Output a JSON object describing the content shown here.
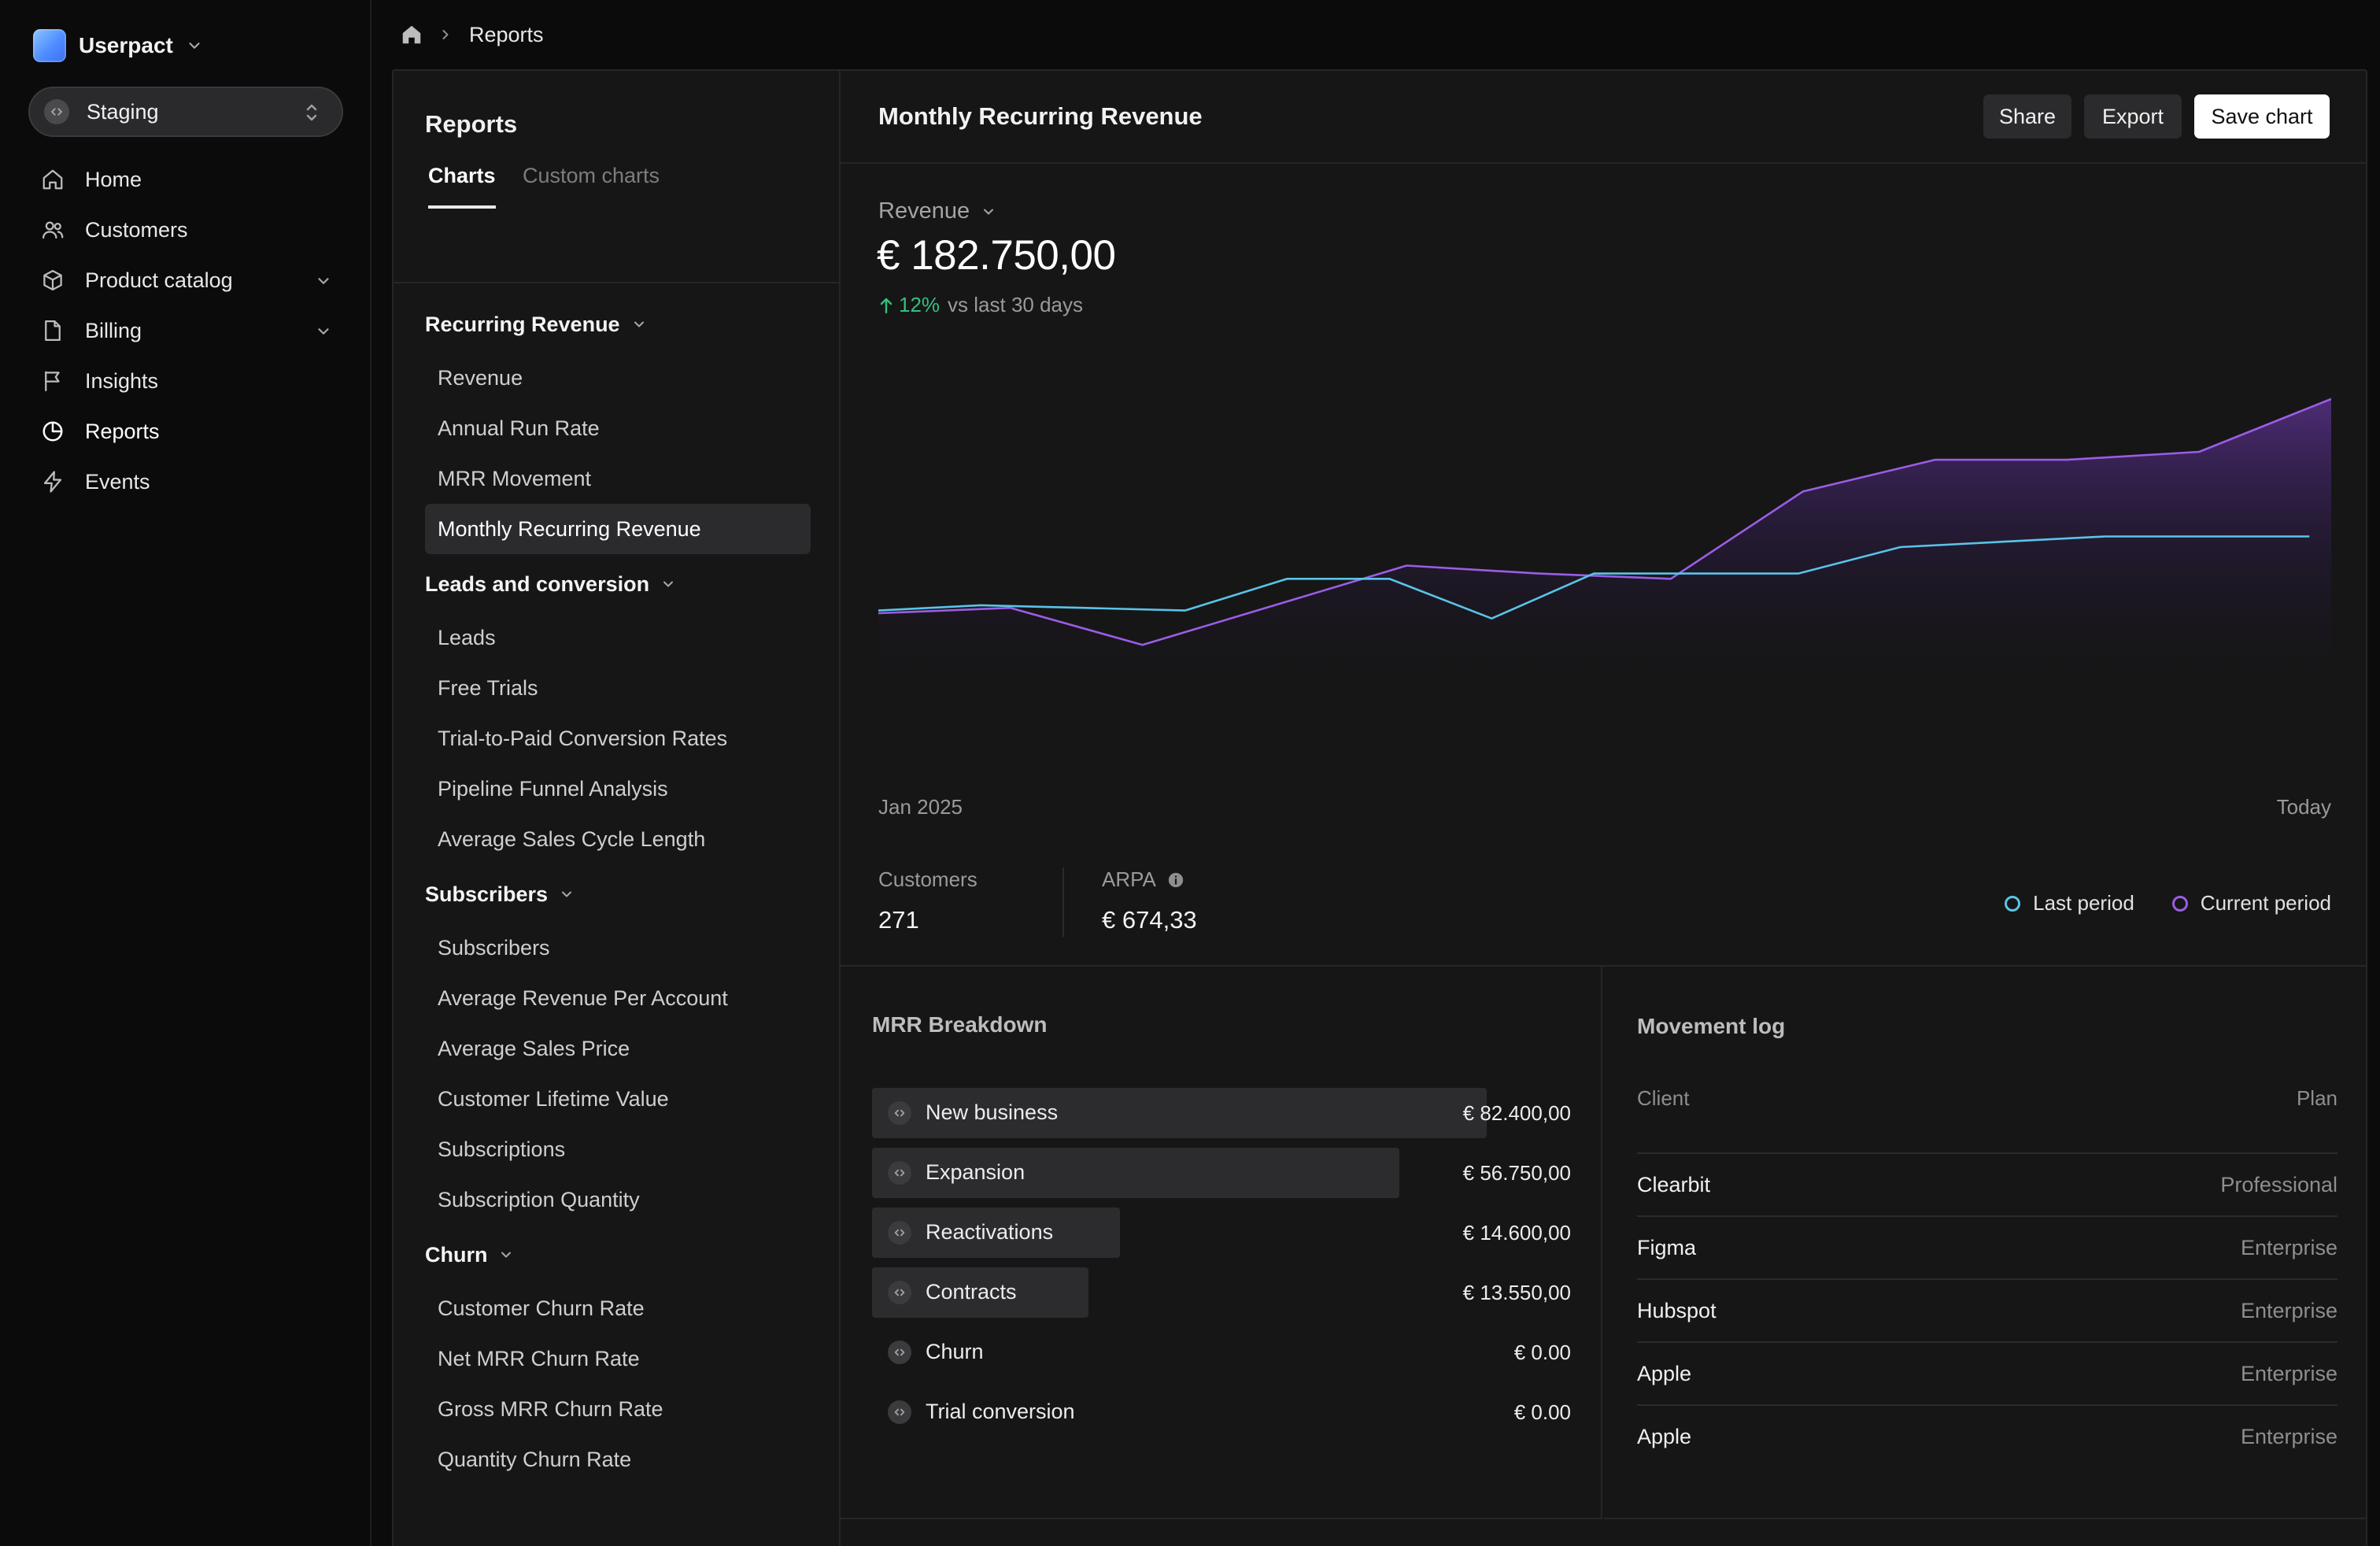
{
  "app": {
    "name": "Userpact",
    "environment": "Staging",
    "brand_color": "#4f8dff"
  },
  "nav": [
    {
      "label": "Home",
      "icon": "home-icon"
    },
    {
      "label": "Customers",
      "icon": "users-icon"
    },
    {
      "label": "Product catalog",
      "icon": "box-icon",
      "expandable": true
    },
    {
      "label": "Billing",
      "icon": "file-icon",
      "expandable": true
    },
    {
      "label": "Insights",
      "icon": "flag-icon"
    },
    {
      "label": "Reports",
      "icon": "pie-chart-icon",
      "active": true
    },
    {
      "label": "Events",
      "icon": "bolt-icon"
    }
  ],
  "breadcrumb": {
    "current": "Reports"
  },
  "reports_sidebar": {
    "title": "Reports",
    "tabs": [
      "Charts",
      "Custom charts"
    ],
    "active_tab": "Charts",
    "sections": [
      {
        "title": "Recurring Revenue",
        "items": [
          "Revenue",
          "Annual Run Rate",
          "MRR Movement",
          "Monthly Recurring Revenue"
        ],
        "active_item": "Monthly Recurring Revenue"
      },
      {
        "title": "Leads and conversion",
        "items": [
          "Leads",
          "Free Trials",
          "Trial-to-Paid Conversion Rates",
          "Pipeline Funnel Analysis",
          "Average Sales Cycle Length"
        ]
      },
      {
        "title": "Subscribers",
        "items": [
          "Subscribers",
          "Average Revenue Per Account",
          "Average Sales Price",
          "Customer Lifetime Value",
          "Subscriptions",
          "Subscription Quantity"
        ]
      },
      {
        "title": "Churn",
        "items": [
          "Customer Churn Rate",
          "Net MRR Churn Rate",
          "Gross MRR Churn Rate",
          "Quantity Churn Rate"
        ]
      }
    ]
  },
  "chart_panel": {
    "title": "Monthly Recurring Revenue",
    "buttons": {
      "share": "Share",
      "export": "Export",
      "save": "Save chart"
    },
    "metric_selector": "Revenue",
    "metric_value": "€ 182.750,00",
    "delta": {
      "value": "12%",
      "direction": "up",
      "text": "vs last 30 days",
      "color": "#35c07e"
    },
    "x_start": "Jan 2025",
    "x_end": "Today",
    "stats": [
      {
        "label": "Customers",
        "value": "271"
      },
      {
        "label": "ARPA",
        "value": "€ 674,33",
        "info_icon": true
      }
    ],
    "legend": [
      {
        "label": "Last period",
        "color": "#5bc3e8"
      },
      {
        "label": "Current period",
        "color": "#9b5de5"
      }
    ]
  },
  "chart_data": {
    "type": "line",
    "x_range": [
      "Jan 2025",
      "Today"
    ],
    "series": [
      {
        "name": "Last period",
        "color": "#5bc3e8",
        "values": [
          0.4,
          0.42,
          0.41,
          0.4,
          0.52,
          0.52,
          0.37,
          0.54,
          0.54,
          0.54,
          0.64,
          0.66,
          0.68,
          0.68,
          0.68
        ]
      },
      {
        "name": "Current period",
        "color": "#9b5de5",
        "area": true,
        "values": [
          0.39,
          0.41,
          0.27,
          0.42,
          0.57,
          0.54,
          0.52,
          0.85,
          0.97,
          0.97,
          1.0,
          1.2
        ]
      }
    ],
    "grid": false
  },
  "breakdown": {
    "title": "MRR Breakdown",
    "rows": [
      {
        "label": "New business",
        "value": "€ 82.400,00",
        "share": 0.88
      },
      {
        "label": "Expansion",
        "value": "€ 56.750,00",
        "share": 0.755
      },
      {
        "label": "Reactivations",
        "value": "€ 14.600,00",
        "share": 0.355
      },
      {
        "label": "Contracts",
        "value": "€ 13.550,00",
        "share": 0.31
      },
      {
        "label": "Churn",
        "value": "€ 0.00",
        "share": 0
      },
      {
        "label": "Trial conversion",
        "value": "€ 0.00",
        "share": 0
      }
    ]
  },
  "movement_log": {
    "title": "Movement log",
    "columns": [
      "Client",
      "Plan"
    ],
    "rows": [
      {
        "client": "Clearbit",
        "plan": "Professional"
      },
      {
        "client": "Figma",
        "plan": "Enterprise"
      },
      {
        "client": "Hubspot",
        "plan": "Enterprise"
      },
      {
        "client": "Apple",
        "plan": "Enterprise"
      },
      {
        "client": "Apple",
        "plan": "Enterprise"
      }
    ]
  }
}
